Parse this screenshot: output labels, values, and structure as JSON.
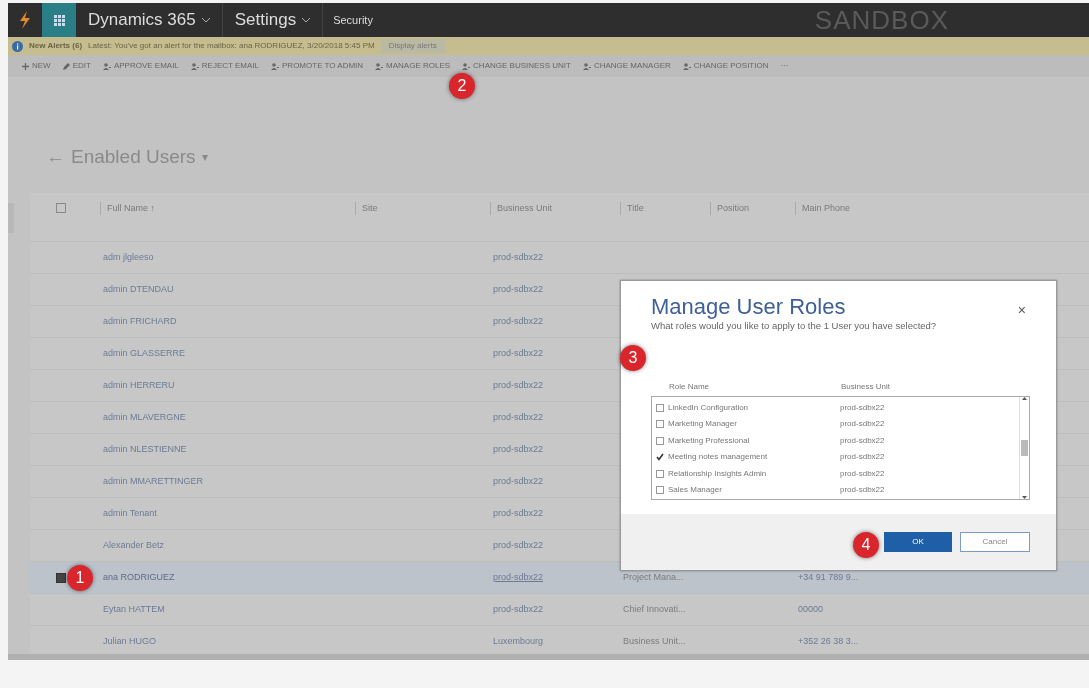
{
  "top_bar": {
    "product": "Dynamics 365",
    "area": "Settings",
    "subarea": "Security",
    "environment": "SANDBOX"
  },
  "alert": {
    "title": "New Alerts (6)",
    "message": "Latest: You've got an alert for the mailbox: ana RODRIGUEZ, 3/20/2018 5:45 PM",
    "link": "Display alerts"
  },
  "commands": [
    {
      "label": "NEW",
      "kind": "plus"
    },
    {
      "label": "EDIT",
      "kind": "pencil"
    },
    {
      "label": "APPROVE EMAIL",
      "kind": "person"
    },
    {
      "label": "REJECT EMAIL",
      "kind": "person"
    },
    {
      "label": "PROMOTE TO ADMIN",
      "kind": "person"
    },
    {
      "label": "MANAGE ROLES",
      "kind": "person"
    },
    {
      "label": "CHANGE BUSINESS UNIT",
      "kind": "person"
    },
    {
      "label": "CHANGE MANAGER",
      "kind": "person"
    },
    {
      "label": "CHANGE POSITION",
      "kind": "person"
    },
    {
      "label": "···",
      "kind": "more"
    }
  ],
  "view": {
    "back": "←",
    "title": "Enabled Users",
    "caret": "▾"
  },
  "table": {
    "select_all": {
      "checked": false
    },
    "columns": [
      "Full Name ↑",
      "Site",
      "Business Unit",
      "Title",
      "Position",
      "Main Phone"
    ],
    "rows": [
      {
        "full_name": "adm jlgleeso",
        "business_unit": "prod-sdbx22",
        "selected": false
      },
      {
        "full_name": "admin DTENDAU",
        "business_unit": "prod-sdbx22",
        "selected": false
      },
      {
        "full_name": "admin FRICHARD",
        "business_unit": "prod-sdbx22",
        "selected": false
      },
      {
        "full_name": "admin GLASSERRE",
        "business_unit": "prod-sdbx22",
        "selected": false
      },
      {
        "full_name": "admin HERRERU",
        "business_unit": "prod-sdbx22",
        "selected": false
      },
      {
        "full_name": "admin MLAVERGNE",
        "business_unit": "prod-sdbx22",
        "selected": false
      },
      {
        "full_name": "admin NLESTIENNE",
        "business_unit": "prod-sdbx22",
        "selected": false
      },
      {
        "full_name": "admin MMARETTINGER",
        "business_unit": "prod-sdbx22",
        "selected": false
      },
      {
        "full_name": "admin Tenant",
        "business_unit": "prod-sdbx22",
        "selected": false
      },
      {
        "full_name": "Alexander Betz",
        "business_unit": "prod-sdbx22",
        "selected": false
      },
      {
        "full_name": "ana RODRIGUEZ",
        "business_unit": "prod-sdbx22",
        "title": "Project Mana...",
        "main_phone": "+34 91 789 9...",
        "selected": true
      },
      {
        "full_name": "Eytan HATTEM",
        "business_unit": "prod-sdbx22",
        "title": "Chief Innovati...",
        "main_phone": "00000",
        "selected": false
      },
      {
        "full_name": "Julian HUGO",
        "business_unit": "Luxembourg",
        "title": "Business Unit...",
        "main_phone": "+352 26 38 3...",
        "selected": false
      }
    ]
  },
  "dialog": {
    "title": "Manage User Roles",
    "subtitle": "What roles would you like to apply to the 1 User you have selected?",
    "close": "×",
    "columns": [
      "Role Name",
      "Business Unit"
    ],
    "roles": [
      {
        "name": "LinkedIn Configuration",
        "business_unit": "prod-sdbx22",
        "checked": false
      },
      {
        "name": "Marketing Manager",
        "business_unit": "prod-sdbx22",
        "checked": false
      },
      {
        "name": "Marketing Professional",
        "business_unit": "prod-sdbx22",
        "checked": false
      },
      {
        "name": "Meeting notes management",
        "business_unit": "prod-sdbx22",
        "checked": true
      },
      {
        "name": "Relationship Insights Admin",
        "business_unit": "prod-sdbx22",
        "checked": false
      },
      {
        "name": "Sales Manager",
        "business_unit": "prod-sdbx22",
        "checked": false
      }
    ],
    "buttons": [
      {
        "label": "OK",
        "kind": "primary"
      },
      {
        "label": "Cancel",
        "kind": "secondary"
      }
    ]
  },
  "annotations": [
    "1",
    "2",
    "3",
    "4"
  ]
}
